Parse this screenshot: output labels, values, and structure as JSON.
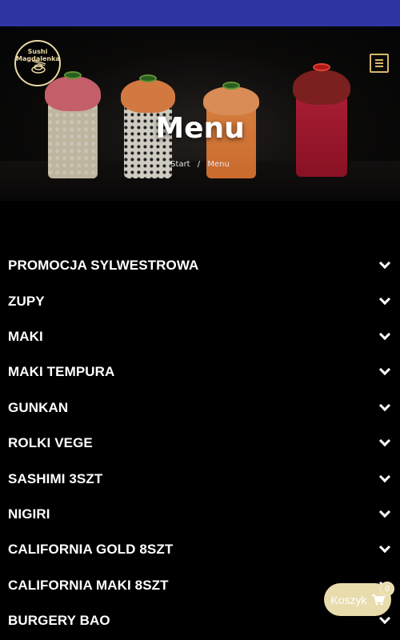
{
  "header": {
    "logo_text": "Sushi Magdalenka",
    "menu_icon": "hamburger-menu-icon"
  },
  "hero": {
    "title": "Menu",
    "breadcrumb": [
      {
        "label": "Start"
      },
      {
        "label": "Menu"
      }
    ],
    "breadcrumb_separator": "/"
  },
  "categories": [
    {
      "label": "PROMOCJA SYLWESTROWA"
    },
    {
      "label": "ZUPY"
    },
    {
      "label": "MAKI"
    },
    {
      "label": "MAKI TEMPURA"
    },
    {
      "label": "GUNKAN"
    },
    {
      "label": "ROLKI VEGE"
    },
    {
      "label": "SASHIMI 3SZT"
    },
    {
      "label": "NIGIRI"
    },
    {
      "label": "CALIFORNIA GOLD 8SZT"
    },
    {
      "label": "CALIFORNIA MAKI 8SZT"
    },
    {
      "label": "BURGERY BAO"
    }
  ],
  "cart": {
    "label": "Koszyk",
    "count": "0",
    "icon": "cart-icon"
  },
  "colors": {
    "topbar": "#2e36a6",
    "accent": "#d9b76a",
    "cart_bg": "#e9dcac",
    "background": "#000000"
  }
}
